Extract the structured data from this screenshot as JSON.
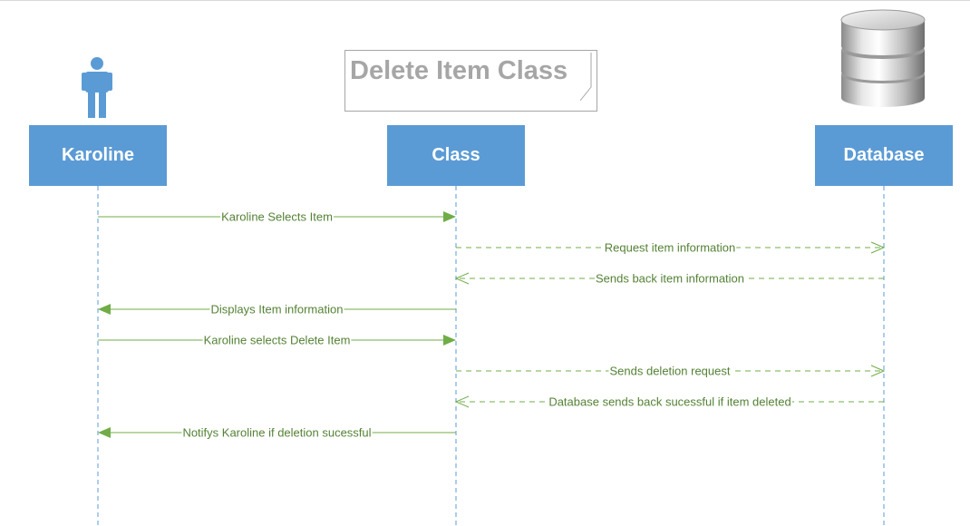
{
  "title": "Delete Item Class",
  "participants": {
    "actor": "Karoline",
    "class": "Class",
    "database": "Database"
  },
  "messages": [
    {
      "label": "Karoline Selects Item",
      "from": "actor",
      "to": "class",
      "style": "solid"
    },
    {
      "label": "Request item information",
      "from": "class",
      "to": "database",
      "style": "dashed"
    },
    {
      "label": "Sends back item information",
      "from": "database",
      "to": "class",
      "style": "dashed"
    },
    {
      "label": "Displays Item information",
      "from": "class",
      "to": "actor",
      "style": "solid"
    },
    {
      "label": "Karoline selects Delete Item",
      "from": "actor",
      "to": "class",
      "style": "solid"
    },
    {
      "label": "Sends deletion request",
      "from": "class",
      "to": "database",
      "style": "dashed"
    },
    {
      "label": "Database sends back sucessful if item deleted",
      "from": "database",
      "to": "class",
      "style": "dashed"
    },
    {
      "label": "Notifys Karoline if deletion sucessful",
      "from": "class",
      "to": "actor",
      "style": "solid"
    }
  ],
  "colors": {
    "participant_fill": "#5b9bd5",
    "message_line": "#70ad47",
    "message_text": "#548235",
    "lifeline": "#5b9bd5",
    "title_text": "#a6a6a6"
  },
  "icons": {
    "actor": "person-icon",
    "database": "database-cylinder-icon"
  }
}
